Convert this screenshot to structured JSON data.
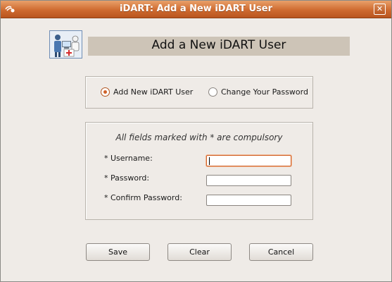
{
  "window": {
    "title": "iDART: Add a New iDART User",
    "menu_icon": "window-menu-icon",
    "close_icon": "close-icon",
    "close_glyph": "✕"
  },
  "header": {
    "title": "Add a New iDART User",
    "icon": "users-admin-icon"
  },
  "mode": {
    "options": [
      {
        "label": "Add New iDART User",
        "selected": true
      },
      {
        "label": "Change Your Password",
        "selected": false
      }
    ]
  },
  "form": {
    "note": "All fields marked with * are compulsory",
    "fields": [
      {
        "label": "* Username:",
        "value": "",
        "focused": true
      },
      {
        "label": "* Password:",
        "value": ""
      },
      {
        "label": "* Confirm Password:",
        "value": ""
      }
    ]
  },
  "buttons": {
    "save": "Save",
    "clear": "Clear",
    "cancel": "Cancel"
  },
  "colors": {
    "titlebar": "#cf6b30",
    "accent": "#d0632a",
    "banner": "#cdc4b7",
    "window_bg": "#efebe7"
  }
}
